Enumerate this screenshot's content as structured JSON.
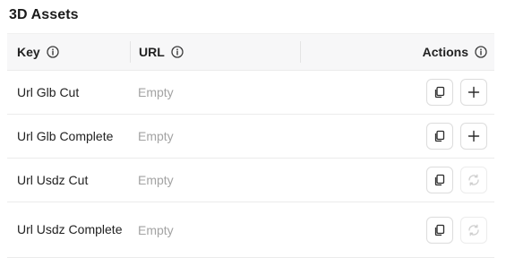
{
  "section": {
    "title": "3D Assets"
  },
  "table": {
    "columns": {
      "key": "Key",
      "url": "URL",
      "actions": "Actions"
    },
    "rows": [
      {
        "key": "Url Glb Cut",
        "url": "Empty",
        "secondary_action": "add"
      },
      {
        "key": "Url Glb Complete",
        "url": "Empty",
        "secondary_action": "add"
      },
      {
        "key": "Url Usdz Cut",
        "url": "Empty",
        "secondary_action": "loading"
      },
      {
        "key": "Url Usdz Complete",
        "url": "Empty",
        "secondary_action": "loading"
      }
    ]
  },
  "icons": {
    "header_info": "info-circle-icon",
    "copy": "copy-icon",
    "add": "plus-icon",
    "loading": "spinner-icon"
  },
  "colors": {
    "header_bg": "#f7f7f8",
    "empty_text": "#a3a3a3",
    "border": "#dcdcdc"
  }
}
